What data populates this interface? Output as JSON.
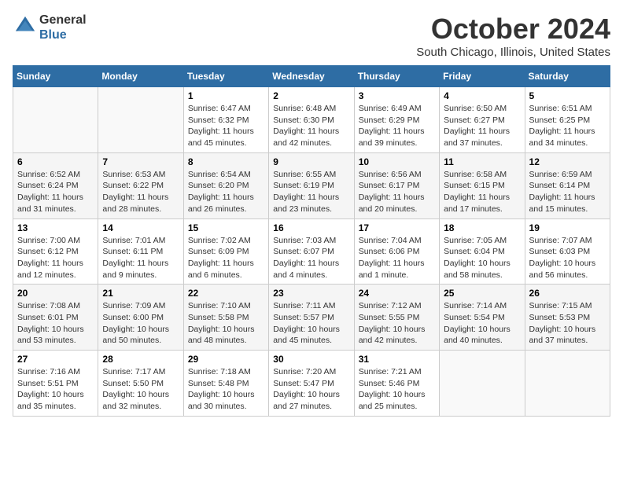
{
  "header": {
    "logo_line1": "General",
    "logo_line2": "Blue",
    "month": "October 2024",
    "location": "South Chicago, Illinois, United States"
  },
  "days_of_week": [
    "Sunday",
    "Monday",
    "Tuesday",
    "Wednesday",
    "Thursday",
    "Friday",
    "Saturday"
  ],
  "weeks": [
    [
      {
        "day": null,
        "content": null
      },
      {
        "day": null,
        "content": null
      },
      {
        "day": 1,
        "sunrise": "Sunrise: 6:47 AM",
        "sunset": "Sunset: 6:32 PM",
        "daylight": "Daylight: 11 hours and 45 minutes."
      },
      {
        "day": 2,
        "sunrise": "Sunrise: 6:48 AM",
        "sunset": "Sunset: 6:30 PM",
        "daylight": "Daylight: 11 hours and 42 minutes."
      },
      {
        "day": 3,
        "sunrise": "Sunrise: 6:49 AM",
        "sunset": "Sunset: 6:29 PM",
        "daylight": "Daylight: 11 hours and 39 minutes."
      },
      {
        "day": 4,
        "sunrise": "Sunrise: 6:50 AM",
        "sunset": "Sunset: 6:27 PM",
        "daylight": "Daylight: 11 hours and 37 minutes."
      },
      {
        "day": 5,
        "sunrise": "Sunrise: 6:51 AM",
        "sunset": "Sunset: 6:25 PM",
        "daylight": "Daylight: 11 hours and 34 minutes."
      }
    ],
    [
      {
        "day": 6,
        "sunrise": "Sunrise: 6:52 AM",
        "sunset": "Sunset: 6:24 PM",
        "daylight": "Daylight: 11 hours and 31 minutes."
      },
      {
        "day": 7,
        "sunrise": "Sunrise: 6:53 AM",
        "sunset": "Sunset: 6:22 PM",
        "daylight": "Daylight: 11 hours and 28 minutes."
      },
      {
        "day": 8,
        "sunrise": "Sunrise: 6:54 AM",
        "sunset": "Sunset: 6:20 PM",
        "daylight": "Daylight: 11 hours and 26 minutes."
      },
      {
        "day": 9,
        "sunrise": "Sunrise: 6:55 AM",
        "sunset": "Sunset: 6:19 PM",
        "daylight": "Daylight: 11 hours and 23 minutes."
      },
      {
        "day": 10,
        "sunrise": "Sunrise: 6:56 AM",
        "sunset": "Sunset: 6:17 PM",
        "daylight": "Daylight: 11 hours and 20 minutes."
      },
      {
        "day": 11,
        "sunrise": "Sunrise: 6:58 AM",
        "sunset": "Sunset: 6:15 PM",
        "daylight": "Daylight: 11 hours and 17 minutes."
      },
      {
        "day": 12,
        "sunrise": "Sunrise: 6:59 AM",
        "sunset": "Sunset: 6:14 PM",
        "daylight": "Daylight: 11 hours and 15 minutes."
      }
    ],
    [
      {
        "day": 13,
        "sunrise": "Sunrise: 7:00 AM",
        "sunset": "Sunset: 6:12 PM",
        "daylight": "Daylight: 11 hours and 12 minutes."
      },
      {
        "day": 14,
        "sunrise": "Sunrise: 7:01 AM",
        "sunset": "Sunset: 6:11 PM",
        "daylight": "Daylight: 11 hours and 9 minutes."
      },
      {
        "day": 15,
        "sunrise": "Sunrise: 7:02 AM",
        "sunset": "Sunset: 6:09 PM",
        "daylight": "Daylight: 11 hours and 6 minutes."
      },
      {
        "day": 16,
        "sunrise": "Sunrise: 7:03 AM",
        "sunset": "Sunset: 6:07 PM",
        "daylight": "Daylight: 11 hours and 4 minutes."
      },
      {
        "day": 17,
        "sunrise": "Sunrise: 7:04 AM",
        "sunset": "Sunset: 6:06 PM",
        "daylight": "Daylight: 11 hours and 1 minute."
      },
      {
        "day": 18,
        "sunrise": "Sunrise: 7:05 AM",
        "sunset": "Sunset: 6:04 PM",
        "daylight": "Daylight: 10 hours and 58 minutes."
      },
      {
        "day": 19,
        "sunrise": "Sunrise: 7:07 AM",
        "sunset": "Sunset: 6:03 PM",
        "daylight": "Daylight: 10 hours and 56 minutes."
      }
    ],
    [
      {
        "day": 20,
        "sunrise": "Sunrise: 7:08 AM",
        "sunset": "Sunset: 6:01 PM",
        "daylight": "Daylight: 10 hours and 53 minutes."
      },
      {
        "day": 21,
        "sunrise": "Sunrise: 7:09 AM",
        "sunset": "Sunset: 6:00 PM",
        "daylight": "Daylight: 10 hours and 50 minutes."
      },
      {
        "day": 22,
        "sunrise": "Sunrise: 7:10 AM",
        "sunset": "Sunset: 5:58 PM",
        "daylight": "Daylight: 10 hours and 48 minutes."
      },
      {
        "day": 23,
        "sunrise": "Sunrise: 7:11 AM",
        "sunset": "Sunset: 5:57 PM",
        "daylight": "Daylight: 10 hours and 45 minutes."
      },
      {
        "day": 24,
        "sunrise": "Sunrise: 7:12 AM",
        "sunset": "Sunset: 5:55 PM",
        "daylight": "Daylight: 10 hours and 42 minutes."
      },
      {
        "day": 25,
        "sunrise": "Sunrise: 7:14 AM",
        "sunset": "Sunset: 5:54 PM",
        "daylight": "Daylight: 10 hours and 40 minutes."
      },
      {
        "day": 26,
        "sunrise": "Sunrise: 7:15 AM",
        "sunset": "Sunset: 5:53 PM",
        "daylight": "Daylight: 10 hours and 37 minutes."
      }
    ],
    [
      {
        "day": 27,
        "sunrise": "Sunrise: 7:16 AM",
        "sunset": "Sunset: 5:51 PM",
        "daylight": "Daylight: 10 hours and 35 minutes."
      },
      {
        "day": 28,
        "sunrise": "Sunrise: 7:17 AM",
        "sunset": "Sunset: 5:50 PM",
        "daylight": "Daylight: 10 hours and 32 minutes."
      },
      {
        "day": 29,
        "sunrise": "Sunrise: 7:18 AM",
        "sunset": "Sunset: 5:48 PM",
        "daylight": "Daylight: 10 hours and 30 minutes."
      },
      {
        "day": 30,
        "sunrise": "Sunrise: 7:20 AM",
        "sunset": "Sunset: 5:47 PM",
        "daylight": "Daylight: 10 hours and 27 minutes."
      },
      {
        "day": 31,
        "sunrise": "Sunrise: 7:21 AM",
        "sunset": "Sunset: 5:46 PM",
        "daylight": "Daylight: 10 hours and 25 minutes."
      },
      {
        "day": null,
        "content": null
      },
      {
        "day": null,
        "content": null
      }
    ]
  ]
}
